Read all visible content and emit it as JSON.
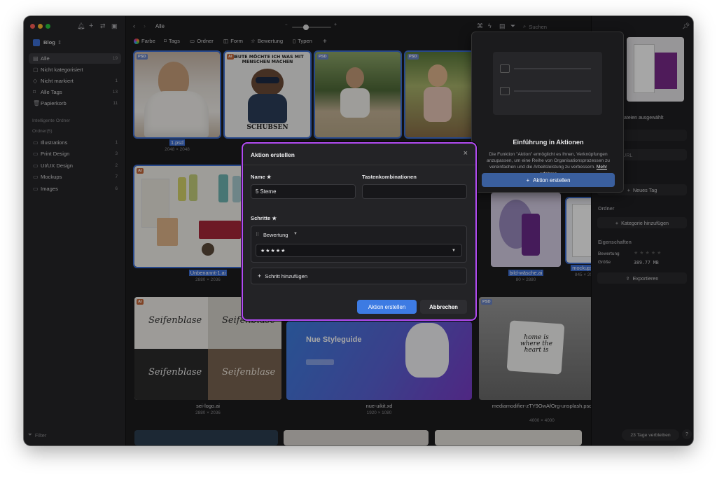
{
  "sidebar": {
    "library_name": "Blog",
    "items": [
      {
        "label": "Alle",
        "count": "19",
        "icon": "all-icon"
      },
      {
        "label": "Nicht kategorisiert",
        "count": "",
        "icon": "uncategorized-icon"
      },
      {
        "label": "Nicht markiert",
        "count": "1",
        "icon": "untagged-icon"
      },
      {
        "label": "Alle Tags",
        "count": "13",
        "icon": "tag-icon"
      },
      {
        "label": "Papierkorb",
        "count": "11",
        "icon": "trash-icon"
      }
    ],
    "smart_folders_label": "Intelligente Ordner",
    "folders_label": "Ordner(5)",
    "folders": [
      {
        "label": "Illustrations",
        "count": "1"
      },
      {
        "label": "Print Design",
        "count": "3"
      },
      {
        "label": "UI/UX Design",
        "count": "2"
      },
      {
        "label": "Mockups",
        "count": "7"
      },
      {
        "label": "Images",
        "count": "6"
      }
    ],
    "filter_placeholder": "Filter"
  },
  "toolbar": {
    "breadcrumb": "Alle",
    "search_placeholder": "Suchen"
  },
  "filters": {
    "farbe": "Farbe",
    "tags": "Tags",
    "ordner": "Ordner",
    "form": "Form",
    "bewertung": "Bewertung",
    "typen": "Typen"
  },
  "grid": {
    "items": [
      {
        "name": "1.psd",
        "dims": "2048 × 2048",
        "badge": "PSD"
      },
      {
        "name": "",
        "dims": "",
        "badge": "AI",
        "art_text_top": "HEUTE MÖCHTE ICH WAS MIT MENSCHEN MACHEN",
        "art_text_bottom": "SCHUBSEN"
      },
      {
        "name": "",
        "dims": "",
        "badge": "PSD"
      },
      {
        "name": "",
        "dims": "",
        "badge": "PSD"
      },
      {
        "name": "Unbenannt-1.ai",
        "dims": "2880 × 2036",
        "badge": "AI"
      },
      {
        "name": "bild-wäsche.ai",
        "dims": "80 × 2880",
        "badge": ""
      },
      {
        "name": "mockups.xd",
        "dims": "845 × 2048",
        "badge": ""
      },
      {
        "name": "sei-logo.ai",
        "dims": "2880 × 2036",
        "badge": "AI",
        "art_text": "Seifenblase"
      },
      {
        "name": "nue-uikit.xd",
        "dims": "1920 × 1080",
        "badge": "",
        "art_text": "Nue Styleguide"
      },
      {
        "name": "mediamodifier-zTY9OwAfOrg-unsplash.psd",
        "dims": "4000 × 4000",
        "badge": "PSD",
        "art_text": "home is where the heart is"
      }
    ]
  },
  "popover": {
    "title": "Einführung in Aktionen",
    "body": "Die Funktion \"Aktion\" ermöglicht es Ihnen, Verknüpfungen anzupassen, um eine Reihe von Organisationsprozessen zu vereinfachen und die Arbeitsleistung zu verbessern.",
    "link": "Mehr erfahren",
    "button": "Aktion erstellen"
  },
  "right_panel": {
    "selected_text": "ateien ausgewählt",
    "url_placeholder": "URL",
    "new_tag": "Neues Tag",
    "folder_heading": "Ordner",
    "add_category": "Kategorie hinzufügen",
    "properties_heading": "Eigenschaften",
    "rating_label": "Bewertung",
    "size_label": "Größe",
    "size_value": "389.77 MB",
    "export": "Exportieren",
    "trial": "23 Tage verbleiben",
    "help": "?"
  },
  "dialog": {
    "title": "Aktion erstellen",
    "name_label": "Name ★",
    "name_value": "5 Sterne",
    "shortcut_label": "Tastenkombinationen",
    "steps_label": "Schritte ★",
    "step_type": "Bewertung",
    "step_value": "★★★★★",
    "add_step": "Schritt hinzufügen",
    "submit": "Aktion erstellen",
    "cancel": "Abbrechen"
  },
  "colors": {
    "accent": "#3d6fd6",
    "dialog_border": "#b24bf3",
    "primary_button": "#3d7be3"
  }
}
